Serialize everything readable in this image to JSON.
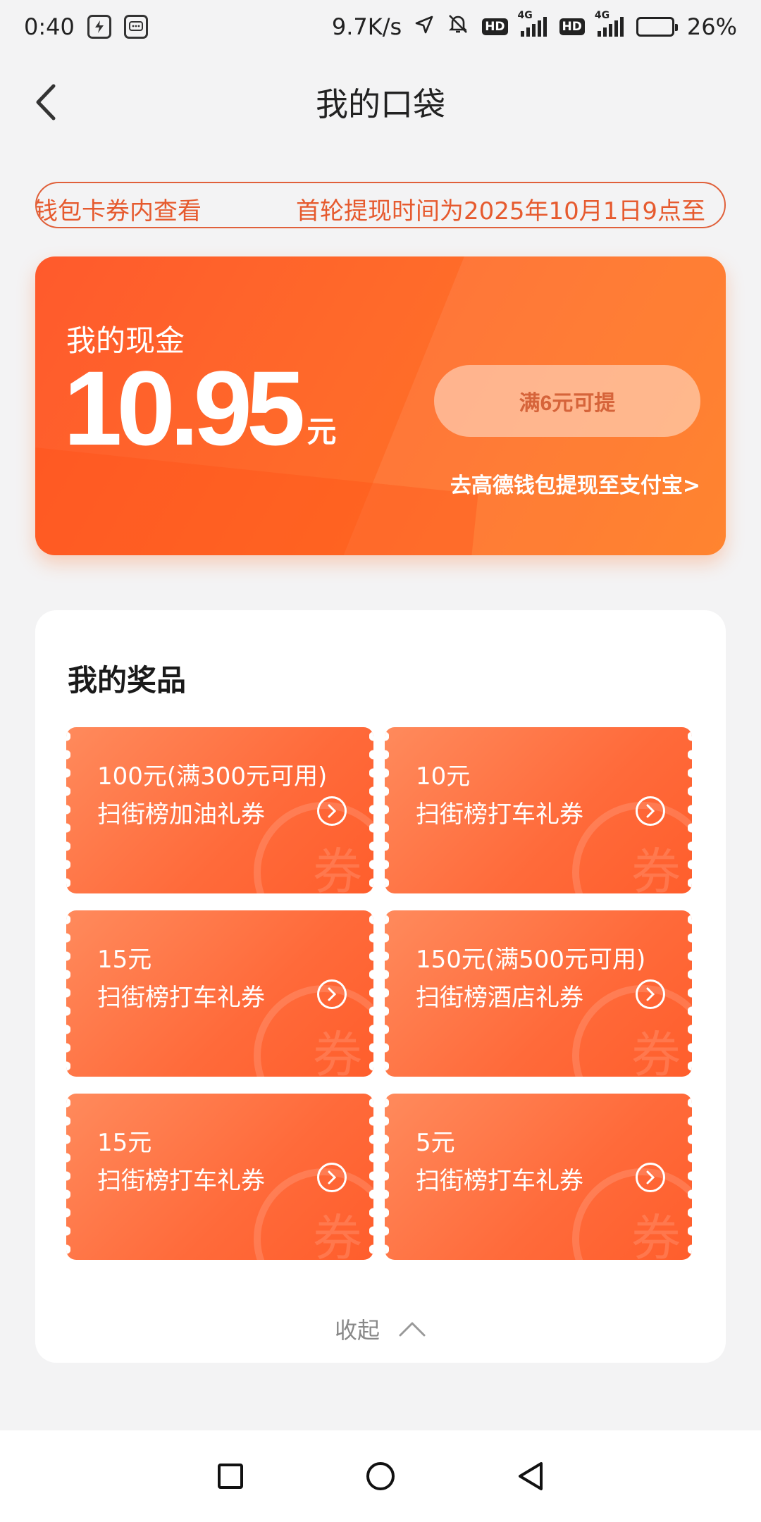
{
  "status_bar": {
    "time": "0:40",
    "speed": "9.7K/s",
    "hd1": "HD",
    "hd2": "HD",
    "net1": "4G",
    "net2": "4G",
    "battery": "26%",
    "battery_level": 0.26,
    "icons": [
      "shield-app-icon",
      "message-app-icon",
      "location-arrow-icon",
      "mute-icon",
      "signal-icon",
      "battery-charging-icon"
    ]
  },
  "header": {
    "title": "我的口袋",
    "back_icon": "chevron-left-icon"
  },
  "notice": {
    "text_left": "钱包卡券内查看",
    "text_right": "首轮提现时间为2025年10月1日9点至"
  },
  "cash": {
    "label": "我的现金",
    "amount": "10.95",
    "unit": "元",
    "withdraw_label": "满6元可提",
    "wallet_link": "去高德钱包提现至支付宝>",
    "colors": {
      "card": "#ff6a2a",
      "button_text": "#d6643a"
    }
  },
  "prizes": {
    "title": "我的奖品",
    "watermark": "券",
    "items": [
      {
        "amount": "100元(满300元可用)",
        "name": "扫街榜加油礼券"
      },
      {
        "amount": "10元",
        "name": "扫街榜打车礼券"
      },
      {
        "amount": "15元",
        "name": "扫街榜打车礼券"
      },
      {
        "amount": "150元(满500元可用)",
        "name": "扫街榜酒店礼券"
      },
      {
        "amount": "15元",
        "name": "扫街榜打车礼券"
      },
      {
        "amount": "5元",
        "name": "扫街榜打车礼券"
      }
    ],
    "collapse_label": "收起",
    "collapse_icon": "chevron-up-icon"
  },
  "nav_bar": {
    "icons": [
      "recent-apps-icon",
      "home-icon",
      "back-icon"
    ]
  }
}
